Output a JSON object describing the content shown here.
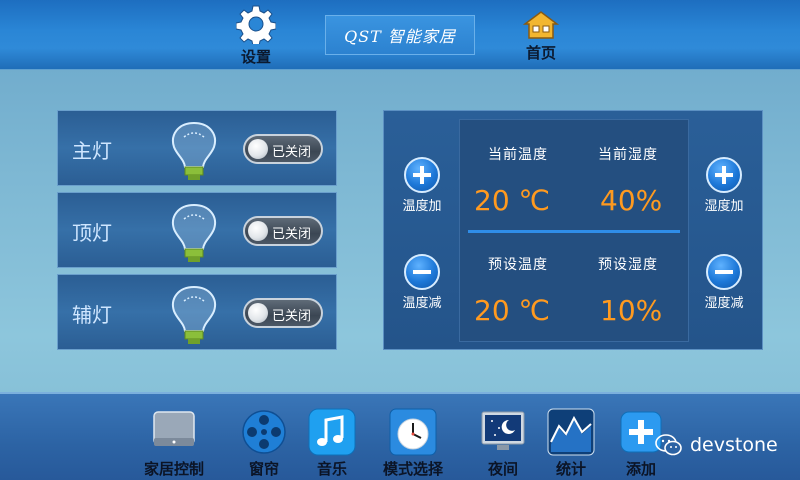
{
  "header": {
    "settings_label": "设置",
    "brand_text": "QST 智能家居",
    "home_label": "首页"
  },
  "lights": [
    {
      "name": "主灯",
      "status": "已关闭"
    },
    {
      "name": "顶灯",
      "status": "已关闭"
    },
    {
      "name": "辅灯",
      "status": "已关闭"
    }
  ],
  "climate": {
    "temp_up_label": "温度加",
    "temp_down_label": "温度减",
    "humidity_up_label": "湿度加",
    "humidity_down_label": "湿度减",
    "current_temp_caption": "当前温度",
    "current_humidity_caption": "当前湿度",
    "preset_temp_caption": "预设温度",
    "preset_humidity_caption": "预设湿度",
    "current_temp_value": "20 ℃",
    "current_humidity_value": "40%",
    "preset_temp_value": "20 ℃",
    "preset_humidity_value": "10%"
  },
  "dock": {
    "items": [
      {
        "label": "家居控制",
        "icon": "monitor-icon"
      },
      {
        "label": "窗帘",
        "icon": "film-reel-icon"
      },
      {
        "label": "音乐",
        "icon": "music-note-icon"
      },
      {
        "label": "模式选择",
        "icon": "clock-icon"
      },
      {
        "label": "夜间",
        "icon": "night-screen-icon"
      },
      {
        "label": "统计",
        "icon": "chart-icon"
      },
      {
        "label": "添加",
        "icon": "plus-icon"
      }
    ]
  },
  "watermark": {
    "text": "devstone"
  },
  "colors": {
    "accent_orange": "#ff9a1f",
    "panel_blue": "#2a5f98",
    "topbar_blue": "#2a86d6"
  }
}
